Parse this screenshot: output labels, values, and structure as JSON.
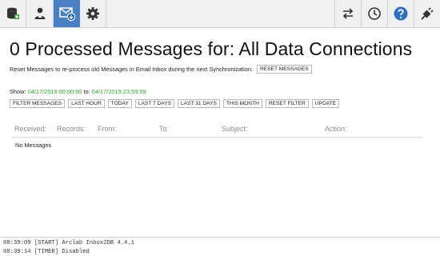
{
  "toolbar": {
    "left_buttons": [
      {
        "icon": "database-add-icon"
      },
      {
        "icon": "user-config-icon"
      },
      {
        "icon": "email-download-icon",
        "active": true
      },
      {
        "icon": "gear-icon"
      }
    ],
    "right_buttons": [
      {
        "icon": "sync-arrows-icon"
      },
      {
        "icon": "clock-icon"
      },
      {
        "icon": "help-icon"
      },
      {
        "icon": "plugin-connector-icon"
      }
    ],
    "active_color": "#4a7fc4"
  },
  "main": {
    "title": "0 Processed Messages for: All Data Connections",
    "reset_text": "Reset Messages to re-process old Messages in Email Inbox during the next Synchronization:",
    "reset_button": "RESET MESSAGES",
    "show_label": "Show:",
    "date_from": "04/17/2019 00:00:00",
    "to_label": "to:",
    "date_to": "04/17/2019 23:59:59",
    "date_color": "#2f9e2f",
    "filter_buttons": {
      "filter": "FILTER MESSAGES",
      "last_hour": "LAST HOUR",
      "today": "TODAY",
      "last_7": "LAST 7 DAYS",
      "last_31": "LAST 31 DAYS",
      "this_month": "THIS MONTH",
      "reset_filter": "RESET FILTER",
      "update": "UPDATE"
    },
    "columns": {
      "received": "Received:",
      "records": "Records:",
      "from": "From:",
      "to": "To:",
      "subject": "Subject:",
      "action": "Action:"
    },
    "empty_text": "No Messages"
  },
  "log": [
    "08:39:09 [START] Arclab Inbox2DB 4.4.1",
    "08:39:14 [TIMER] Disabled"
  ]
}
